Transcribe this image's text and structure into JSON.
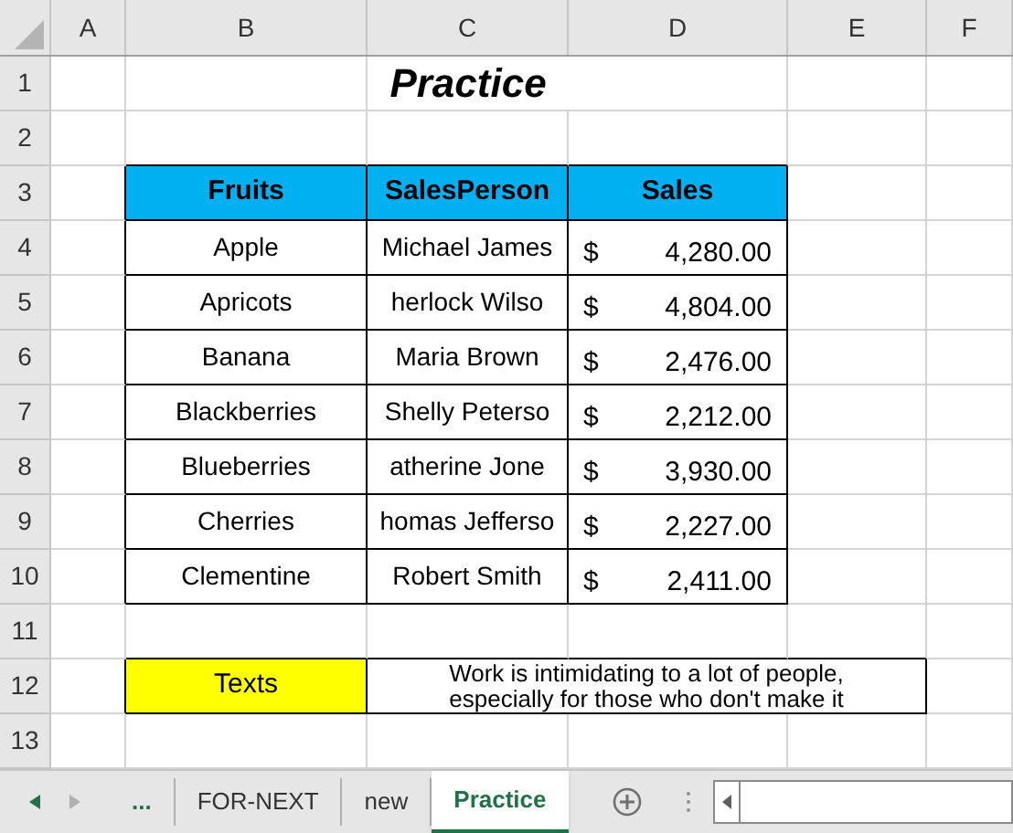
{
  "column_headers": [
    "A",
    "B",
    "C",
    "D",
    "E",
    "F"
  ],
  "row_headers": [
    "1",
    "2",
    "3",
    "4",
    "5",
    "6",
    "7",
    "8",
    "9",
    "10",
    "11",
    "12",
    "13"
  ],
  "title": "Practice",
  "table": {
    "columns": [
      "Fruits",
      "SalesPerson",
      "Sales"
    ],
    "rows": [
      {
        "fruit": "Apple",
        "salesperson": "Michael James",
        "currency": "$",
        "sales": "4,280.00"
      },
      {
        "fruit": "Apricots",
        "salesperson": "herlock Wilso",
        "currency": "$",
        "sales": "4,804.00"
      },
      {
        "fruit": "Banana",
        "salesperson": "Maria Brown",
        "currency": "$",
        "sales": "2,476.00"
      },
      {
        "fruit": "Blackberries",
        "salesperson": "Shelly Peterso",
        "currency": "$",
        "sales": "2,212.00"
      },
      {
        "fruit": "Blueberries",
        "salesperson": "atherine Jone",
        "currency": "$",
        "sales": "3,930.00"
      },
      {
        "fruit": "Cherries",
        "salesperson": "homas Jefferso",
        "currency": "$",
        "sales": "2,227.00"
      },
      {
        "fruit": "Clementine",
        "salesperson": "Robert Smith",
        "currency": "$",
        "sales": "2,411.00"
      }
    ]
  },
  "note": {
    "label": "Texts",
    "lines": [
      "Work is intimidating to a lot of people,",
      "especially for those who don't make it"
    ]
  },
  "tab_overflow": "...",
  "sheet_tabs": [
    {
      "label": "FOR-NEXT",
      "selected": false
    },
    {
      "label": "new",
      "selected": false
    },
    {
      "label": "Practice",
      "selected": true
    }
  ]
}
